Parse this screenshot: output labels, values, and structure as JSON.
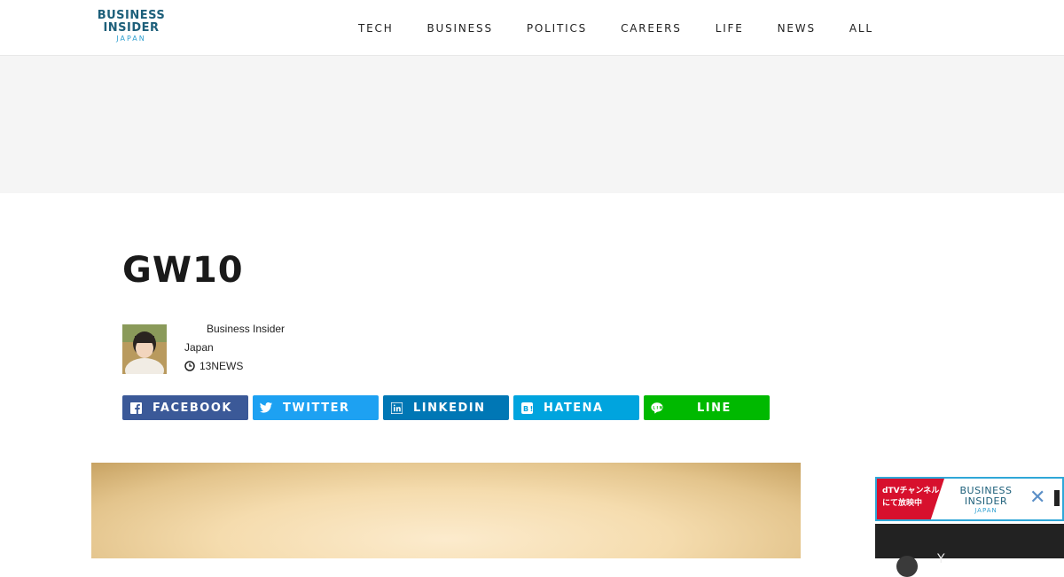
{
  "site": {
    "logo_line1": "BUSINESS",
    "logo_line2": "INSIDER",
    "logo_sub": "JAPAN"
  },
  "nav": {
    "items": [
      {
        "label": "TECH"
      },
      {
        "label": "BUSINESS"
      },
      {
        "label": "POLITICS"
      },
      {
        "label": "CAREERS"
      },
      {
        "label": "LIFE"
      },
      {
        "label": "NEWS"
      },
      {
        "label": "ALL"
      }
    ]
  },
  "article": {
    "title": "GW10",
    "author_line1": "Business Insider",
    "author_line2": "Japan",
    "time": "13",
    "category": "NEWS"
  },
  "share": {
    "facebook": "FACEBOOK",
    "twitter": "TWITTER",
    "linkedin": "LINKEDIN",
    "hatena": "HATENA",
    "line": "LINE"
  },
  "video_ad": {
    "badge_line1": "dTVチャンネル",
    "badge_line2": "にて放映中",
    "logo_line1": "BUSINESS",
    "logo_line2": "INSIDER",
    "logo_sub": "JAPAN",
    "close_symbol": "✕",
    "player_text": "Y"
  },
  "colors": {
    "brand": "#1d5f7a",
    "facebook": "#3b5998",
    "twitter": "#1da1f2",
    "linkedin": "#0077b5",
    "hatena": "#00a4de",
    "line": "#00b900"
  }
}
